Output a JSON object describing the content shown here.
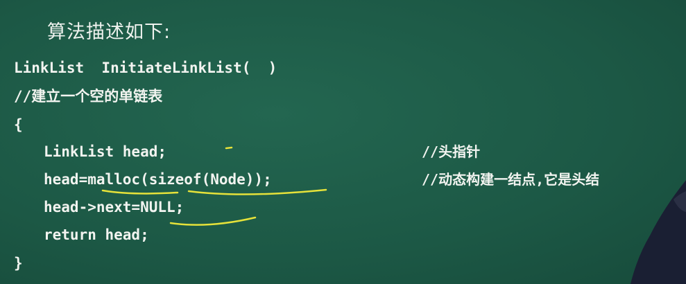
{
  "slide": {
    "heading": "算法描述如下:",
    "code_lines": [
      "LinkList  InitiateLinkList(  )",
      "//建立一个空的单链表",
      "{",
      "LinkList head;",
      "head=malloc(sizeof(Node));",
      "head->next=NULL;",
      "return head;",
      "}"
    ],
    "comments": [
      "//头指针",
      "//动态构建一结点,它是头结"
    ]
  },
  "colors": {
    "background": "#1d5a48",
    "text": "#f2f4f0",
    "annotation": "#e6e23a"
  }
}
